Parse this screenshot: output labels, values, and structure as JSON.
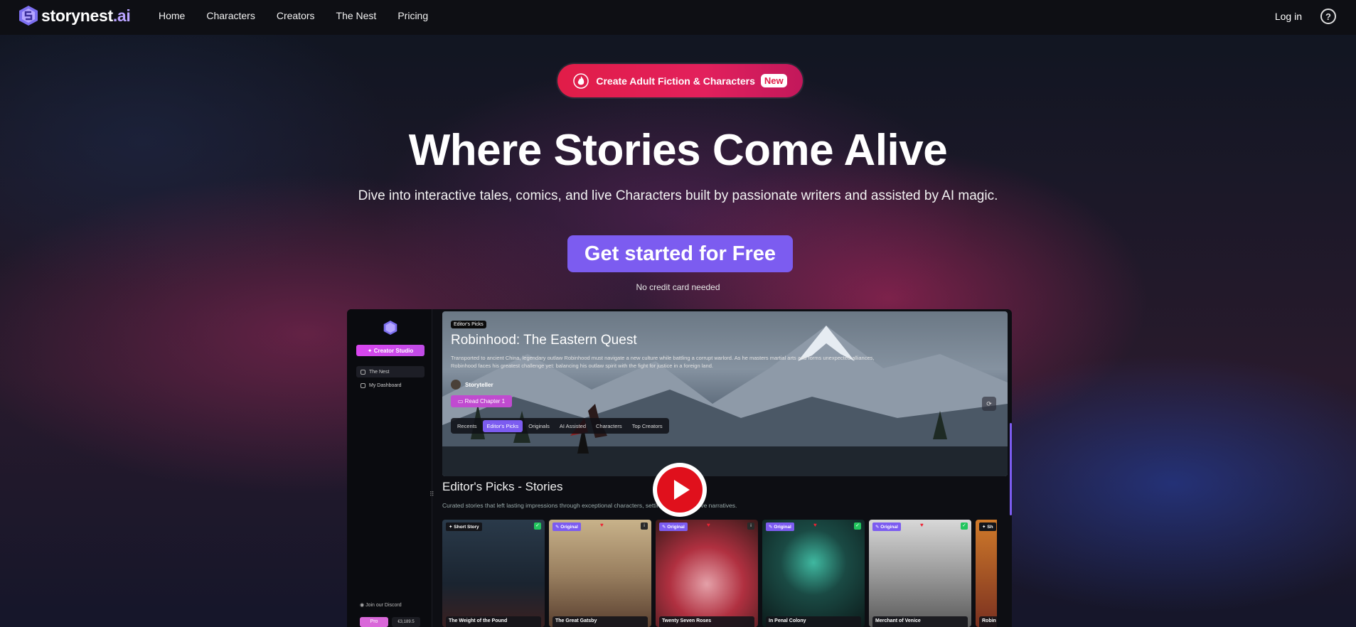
{
  "brand": {
    "name_main": "storynest",
    "name_suffix": ".ai"
  },
  "nav": {
    "links": [
      "Home",
      "Characters",
      "Creators",
      "The Nest",
      "Pricing"
    ],
    "login": "Log in",
    "help": "?"
  },
  "hero": {
    "pill_text": "Create Adult Fiction & Characters",
    "pill_badge": "New",
    "title": "Where Stories Come Alive",
    "subtitle": "Dive into interactive tales, comics, and live Characters built by passionate writers and assisted by AI magic.",
    "cta": "Get started for Free",
    "cta_note": "No credit card needed"
  },
  "preview": {
    "sidebar": {
      "creator_button": "Creator Studio",
      "items": [
        "The Nest",
        "My Dashboard"
      ],
      "discord": "Join our Discord",
      "pro": "Pro",
      "credits": "€3,189.5"
    },
    "banner": {
      "tag": "Editor's Picks",
      "title": "Robinhood: The Eastern Quest",
      "description": "Transported to ancient China, legendary outlaw Robinhood must navigate a new culture while battling a corrupt warlord. As he masters martial arts and forms unexpected alliances, Robinhood faces his greatest challenge yet: balancing his outlaw spirit with the fight for justice in a foreign land.",
      "author": "Storyteller",
      "read_button": "Read Chapter 1",
      "refresh": "⟳"
    },
    "tabs": [
      "Recents",
      "Editor's Picks",
      "Originals",
      "AI Assisted",
      "Characters",
      "Top Creators"
    ],
    "active_tab": "Editor's Picks",
    "section_title": "Editor's Picks - Stories",
    "section_subtitle": "Curated stories that left lasting impressions through exceptional characters, settings and innovative narratives.",
    "cards": [
      {
        "badge": "Short Story",
        "title": "The Weight of the Pound"
      },
      {
        "badge": "Original",
        "title": "The Great Gatsby"
      },
      {
        "badge": "Original",
        "title": "Twenty Seven Roses"
      },
      {
        "badge": "Original",
        "title": "In Penal Colony"
      },
      {
        "badge": "Original",
        "title": "Merchant of Venice"
      },
      {
        "badge": "Sh",
        "title": "Robin"
      }
    ]
  },
  "colors": {
    "accent": "#7c5cf0",
    "pill": "#e11d48",
    "play": "#e0101c"
  }
}
